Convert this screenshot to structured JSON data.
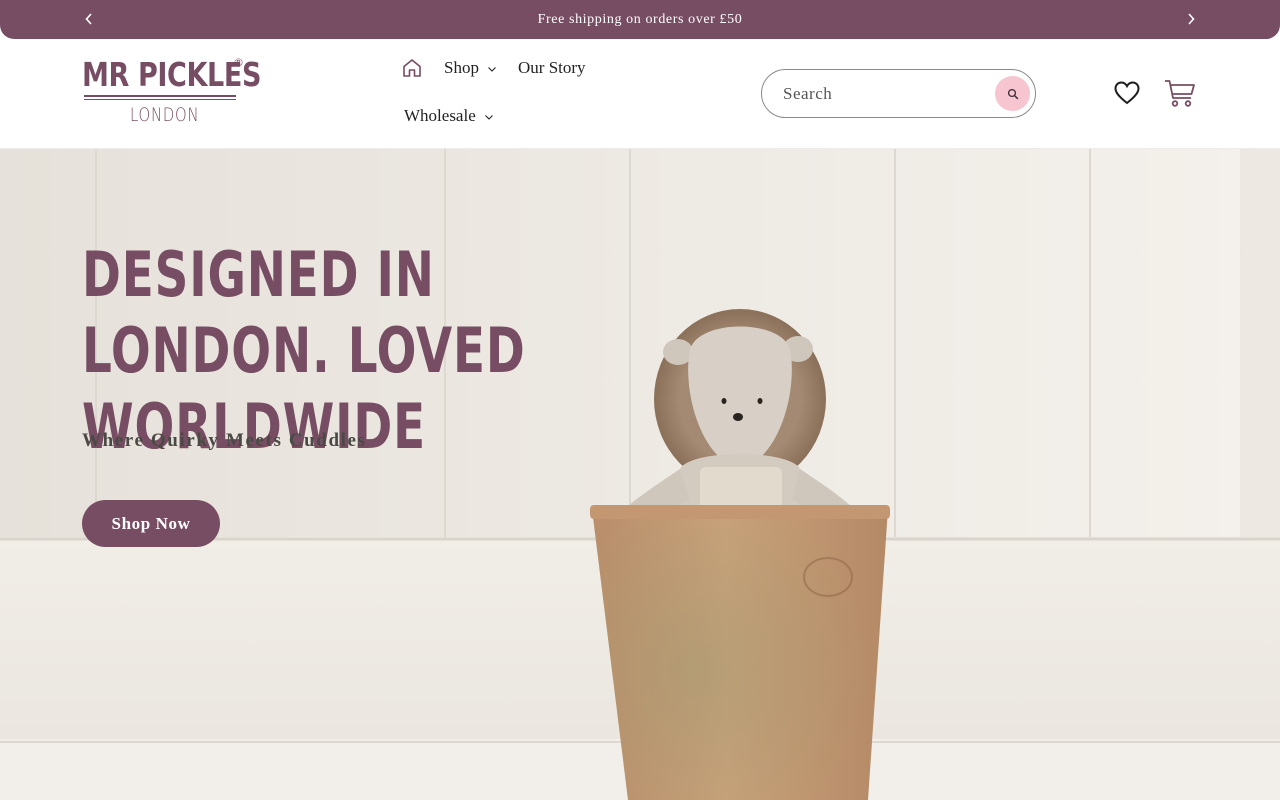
{
  "announcement": {
    "text": "Free shipping on orders over £50",
    "prev_icon": "chevron-left-icon",
    "next_icon": "chevron-right-icon"
  },
  "header": {
    "logo": {
      "main": "MR PICKLES",
      "registered": "®",
      "sub": "LONDON"
    },
    "nav": {
      "home_icon": "home-icon",
      "items": [
        {
          "label": "Shop",
          "has_dropdown": true
        },
        {
          "label": "Our Story",
          "has_dropdown": false
        },
        {
          "label": "Wholesale",
          "has_dropdown": true
        }
      ]
    },
    "search": {
      "placeholder": "Search",
      "value": "",
      "icon": "search-icon"
    },
    "wishlist_icon": "heart-icon",
    "cart_icon": "cart-icon"
  },
  "hero": {
    "title": "Designed in London. Loved Worldwide",
    "subtitle": "Where Quirky Meets Cuddles",
    "cta_label": "Shop Now"
  },
  "colors": {
    "brand": "#774d63",
    "search_button": "#f6c5cf",
    "hero_background": "#ece8e2"
  }
}
